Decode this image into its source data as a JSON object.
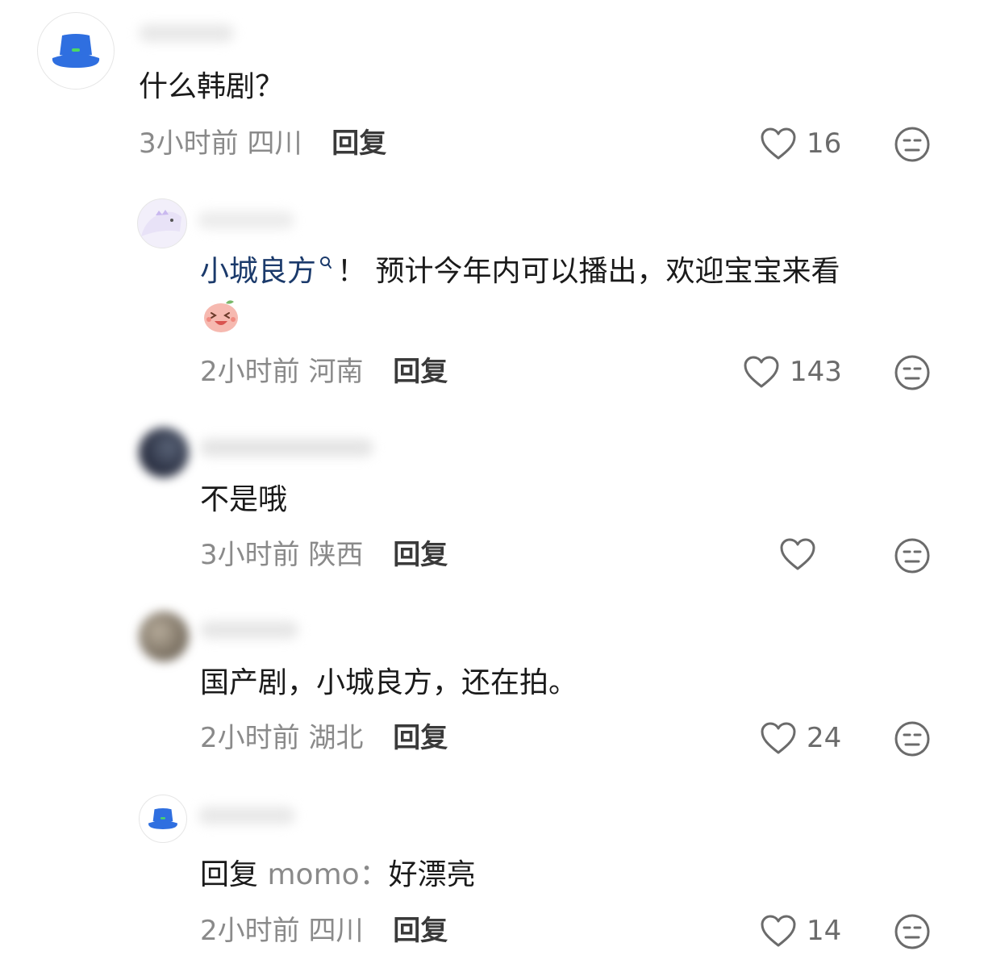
{
  "comments": [
    {
      "content": "什么韩剧？",
      "time": "3小时前",
      "location": "四川",
      "reply_label": "回复",
      "likes": "16"
    },
    {
      "link_text": "小城良方",
      "content_after_link": "！ 预计今年内可以播出，欢迎宝宝来看",
      "emoji": "laughing-sticker",
      "time": "2小时前",
      "location": "河南",
      "reply_label": "回复",
      "likes": "143"
    },
    {
      "content": "不是哦",
      "time": "3小时前",
      "location": "陕西",
      "reply_label": "回复",
      "likes": ""
    },
    {
      "content": "国产剧，小城良方，还在拍。",
      "time": "2小时前",
      "location": "湖北",
      "reply_label": "回复",
      "likes": "24"
    },
    {
      "reply_prefix": "回复",
      "reply_to": "momo：",
      "content": "好漂亮",
      "time": "2小时前",
      "location": "四川",
      "reply_label": "回复",
      "likes": "14"
    }
  ],
  "colors": {
    "hat_blue": "#2f6fe0",
    "hat_dot": "#4cd964",
    "link": "#1b3a6b",
    "meta_gray": "#8a8a8a"
  }
}
